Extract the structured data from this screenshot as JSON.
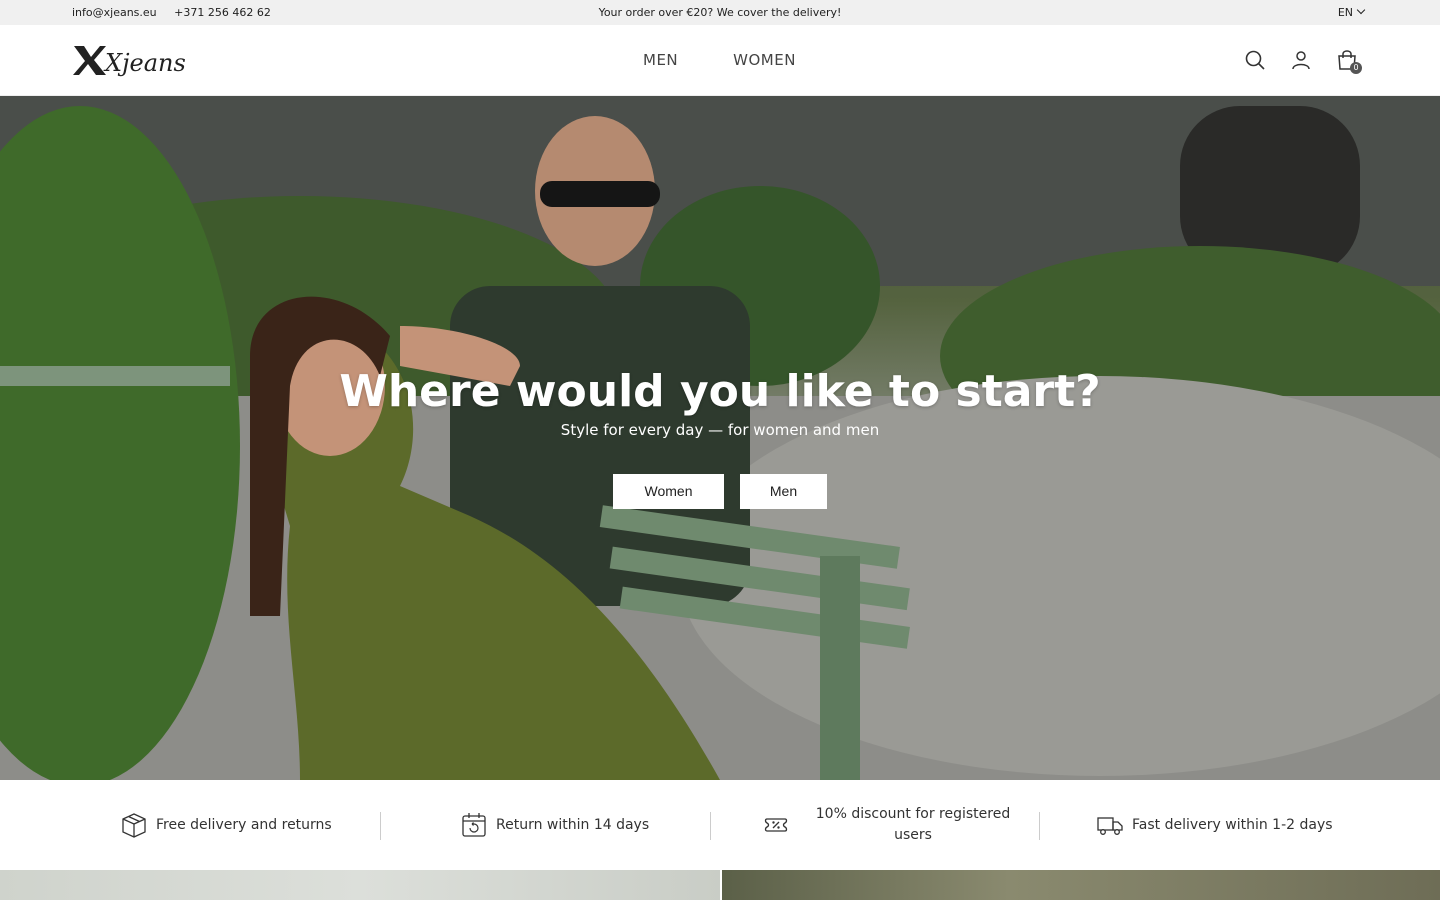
{
  "topbar": {
    "email": "info@xjeans.eu",
    "phone": "+371 256 462 62",
    "promo": "Your order over €20? We cover the delivery!",
    "language": "EN"
  },
  "header": {
    "logo_text": "Xjeans",
    "nav": [
      {
        "label": "MEN"
      },
      {
        "label": "WOMEN"
      }
    ],
    "cart_count": "0"
  },
  "hero": {
    "title": "Where would you like to start?",
    "subtitle": "Style for every day — for women and men",
    "buttons": [
      {
        "label": "Women"
      },
      {
        "label": "Men"
      }
    ]
  },
  "benefits": [
    {
      "icon": "box-icon",
      "text": "Free delivery and returns"
    },
    {
      "icon": "calendar-return-icon",
      "text": "Return within 14 days"
    },
    {
      "icon": "discount-tag-icon",
      "text": "10% discount for registered users"
    },
    {
      "icon": "truck-icon",
      "text": "Fast delivery within 1-2 days"
    }
  ]
}
